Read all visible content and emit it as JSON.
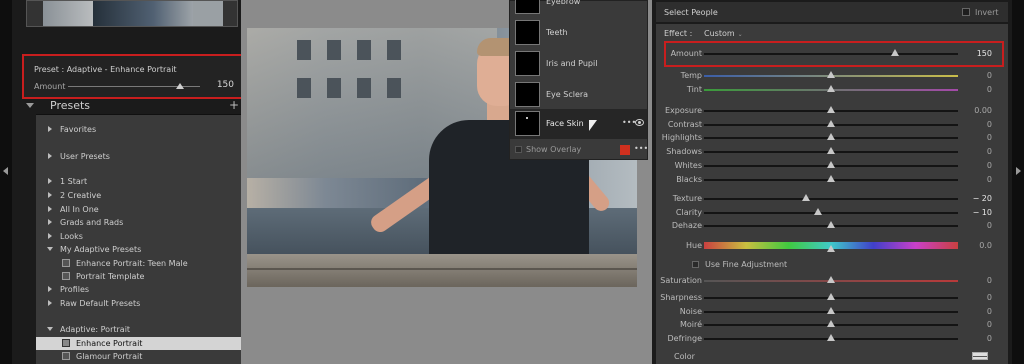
{
  "left_panel": {
    "preset_title": "Preset : Adaptive - Enhance Portrait",
    "amount_label": "Amount",
    "amount_value": "150",
    "amount_fraction": 0.85,
    "presets_header": "Presets",
    "add_icon": "+",
    "items": [
      {
        "label": "Favorites",
        "kind": "group-collapsed"
      },
      {
        "label": "User Presets",
        "kind": "group-collapsed"
      },
      {
        "label": "1 Start",
        "kind": "group-collapsed"
      },
      {
        "label": "2 Creative",
        "kind": "group-collapsed"
      },
      {
        "label": "All In One",
        "kind": "group-collapsed"
      },
      {
        "label": "Grads and Rads",
        "kind": "group-collapsed"
      },
      {
        "label": "Looks",
        "kind": "group-collapsed"
      },
      {
        "label": "My Adaptive Presets",
        "kind": "group-expanded"
      },
      {
        "label": "Enhance Portrait: Teen Male",
        "kind": "preset"
      },
      {
        "label": "Portrait Template",
        "kind": "preset"
      },
      {
        "label": "Profiles",
        "kind": "group-collapsed"
      },
      {
        "label": "Raw Default Presets",
        "kind": "group-collapsed"
      },
      {
        "label": "Adaptive: Portrait",
        "kind": "group-expanded"
      },
      {
        "label": "Enhance Portrait",
        "kind": "preset-selected"
      },
      {
        "label": "Glamour Portrait",
        "kind": "preset"
      }
    ]
  },
  "face_menu": {
    "items": [
      {
        "label": "Eyebrow"
      },
      {
        "label": "Teeth"
      },
      {
        "label": "Iris and Pupil"
      },
      {
        "label": "Eye Sclera"
      },
      {
        "label": "Face Skin",
        "active": true
      }
    ],
    "more_icon": "•••",
    "show_overlay_label": "Show Overlay",
    "overlay_color": "#d0301e"
  },
  "right_panel": {
    "header": "Select People",
    "invert_label": "Invert",
    "effect_label": "Effect :",
    "effect_value": "Custom",
    "sliders": [
      {
        "label": "Amount",
        "value": "150",
        "pos": 0.75,
        "highlight": true
      },
      {
        "label": "Temp",
        "value": "0",
        "pos": 0.5,
        "track": "temp"
      },
      {
        "label": "Tint",
        "value": "0",
        "pos": 0.5,
        "track": "tint"
      },
      {
        "label": "Exposure",
        "value": "0.00",
        "pos": 0.5
      },
      {
        "label": "Contrast",
        "value": "0",
        "pos": 0.5
      },
      {
        "label": "Highlights",
        "value": "0",
        "pos": 0.5
      },
      {
        "label": "Shadows",
        "value": "0",
        "pos": 0.5
      },
      {
        "label": "Whites",
        "value": "0",
        "pos": 0.5
      },
      {
        "label": "Blacks",
        "value": "0",
        "pos": 0.5
      },
      {
        "label": "Texture",
        "value": "− 20",
        "pos": 0.4,
        "valhi": true
      },
      {
        "label": "Clarity",
        "value": "− 10",
        "pos": 0.45,
        "valhi": true
      },
      {
        "label": "Dehaze",
        "value": "0",
        "pos": 0.5
      },
      {
        "label": "Hue",
        "value": "0.0",
        "pos": 0.5,
        "track": "hue"
      },
      {
        "label": "Saturation",
        "value": "0",
        "pos": 0.5,
        "track": "sat"
      },
      {
        "label": "Sharpness",
        "value": "0",
        "pos": 0.5
      },
      {
        "label": "Noise",
        "value": "0",
        "pos": 0.5
      },
      {
        "label": "Moiré",
        "value": "0",
        "pos": 0.5
      },
      {
        "label": "Defringe",
        "value": "0",
        "pos": 0.5
      }
    ],
    "fine_adjust_label": "Use Fine Adjustment",
    "color_label": "Color"
  }
}
